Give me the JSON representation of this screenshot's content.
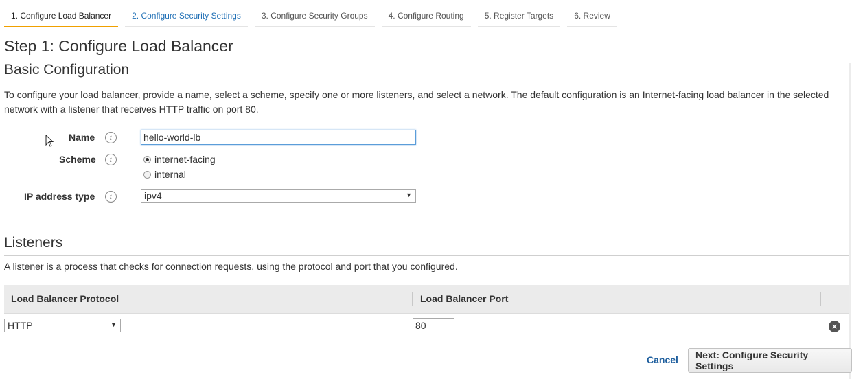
{
  "tabs": [
    {
      "label": "1. Configure Load Balancer"
    },
    {
      "label": "2. Configure Security Settings"
    },
    {
      "label": "3. Configure Security Groups"
    },
    {
      "label": "4. Configure Routing"
    },
    {
      "label": "5. Register Targets"
    },
    {
      "label": "6. Review"
    }
  ],
  "page": {
    "title": "Step 1: Configure Load Balancer"
  },
  "basic": {
    "heading": "Basic Configuration",
    "description": "To configure your load balancer, provide a name, select a scheme, specify one or more listeners, and select a network. The default configuration is an Internet-facing load balancer in the selected network with a listener that receives HTTP traffic on port 80.",
    "name_label": "Name",
    "name_value": "hello-world-lb",
    "scheme_label": "Scheme",
    "scheme_options": [
      "internet-facing",
      "internal"
    ],
    "scheme_selected": "internet-facing",
    "ip_label": "IP address type",
    "ip_value": "ipv4",
    "info_glyph": "i"
  },
  "listeners": {
    "heading": "Listeners",
    "description": "A listener is a process that checks for connection requests, using the protocol and port that you configured.",
    "columns": [
      "Load Balancer Protocol",
      "Load Balancer Port"
    ],
    "rows": [
      {
        "protocol": "HTTP",
        "port": "80"
      }
    ],
    "remove_icon": "remove-icon"
  },
  "footer": {
    "cancel_label": "Cancel",
    "next_label": "Next: Configure Security Settings"
  },
  "colors": {
    "active_tab_accent": "#f0a000",
    "link": "#1f6fb5"
  }
}
